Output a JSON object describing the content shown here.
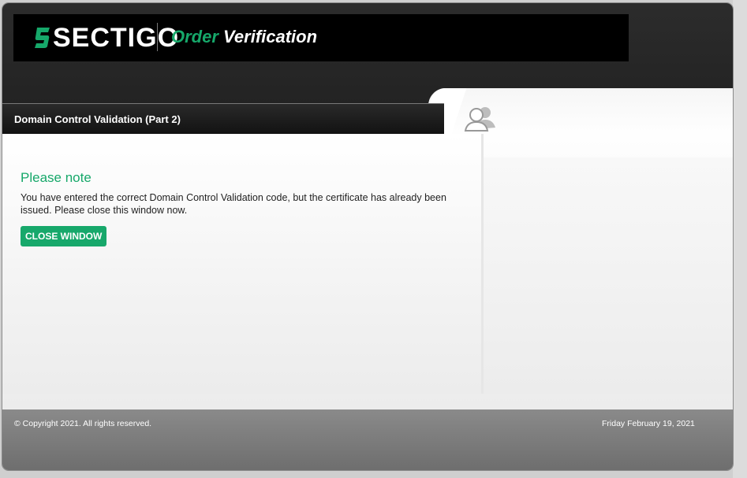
{
  "header": {
    "logo_text": "SECTIGO",
    "title_accent": "Order",
    "title_rest": "Verification"
  },
  "tab": {
    "label": "Domain Control Validation (Part 2)"
  },
  "note": {
    "title": "Please note",
    "text": "You have entered the correct Domain Control Validation code, but the certificate has already been issued. Please close this window now.",
    "button_label": "CLOSE WINDOW"
  },
  "footer": {
    "copyright": "© Copyright 2021. All rights reserved.",
    "date": "Friday February 19, 2021"
  },
  "colors": {
    "accent": "#16a86a",
    "header_bg": "#000000",
    "footer_bg": "#7a7a7a"
  },
  "icons": [
    "user-group-icon"
  ]
}
